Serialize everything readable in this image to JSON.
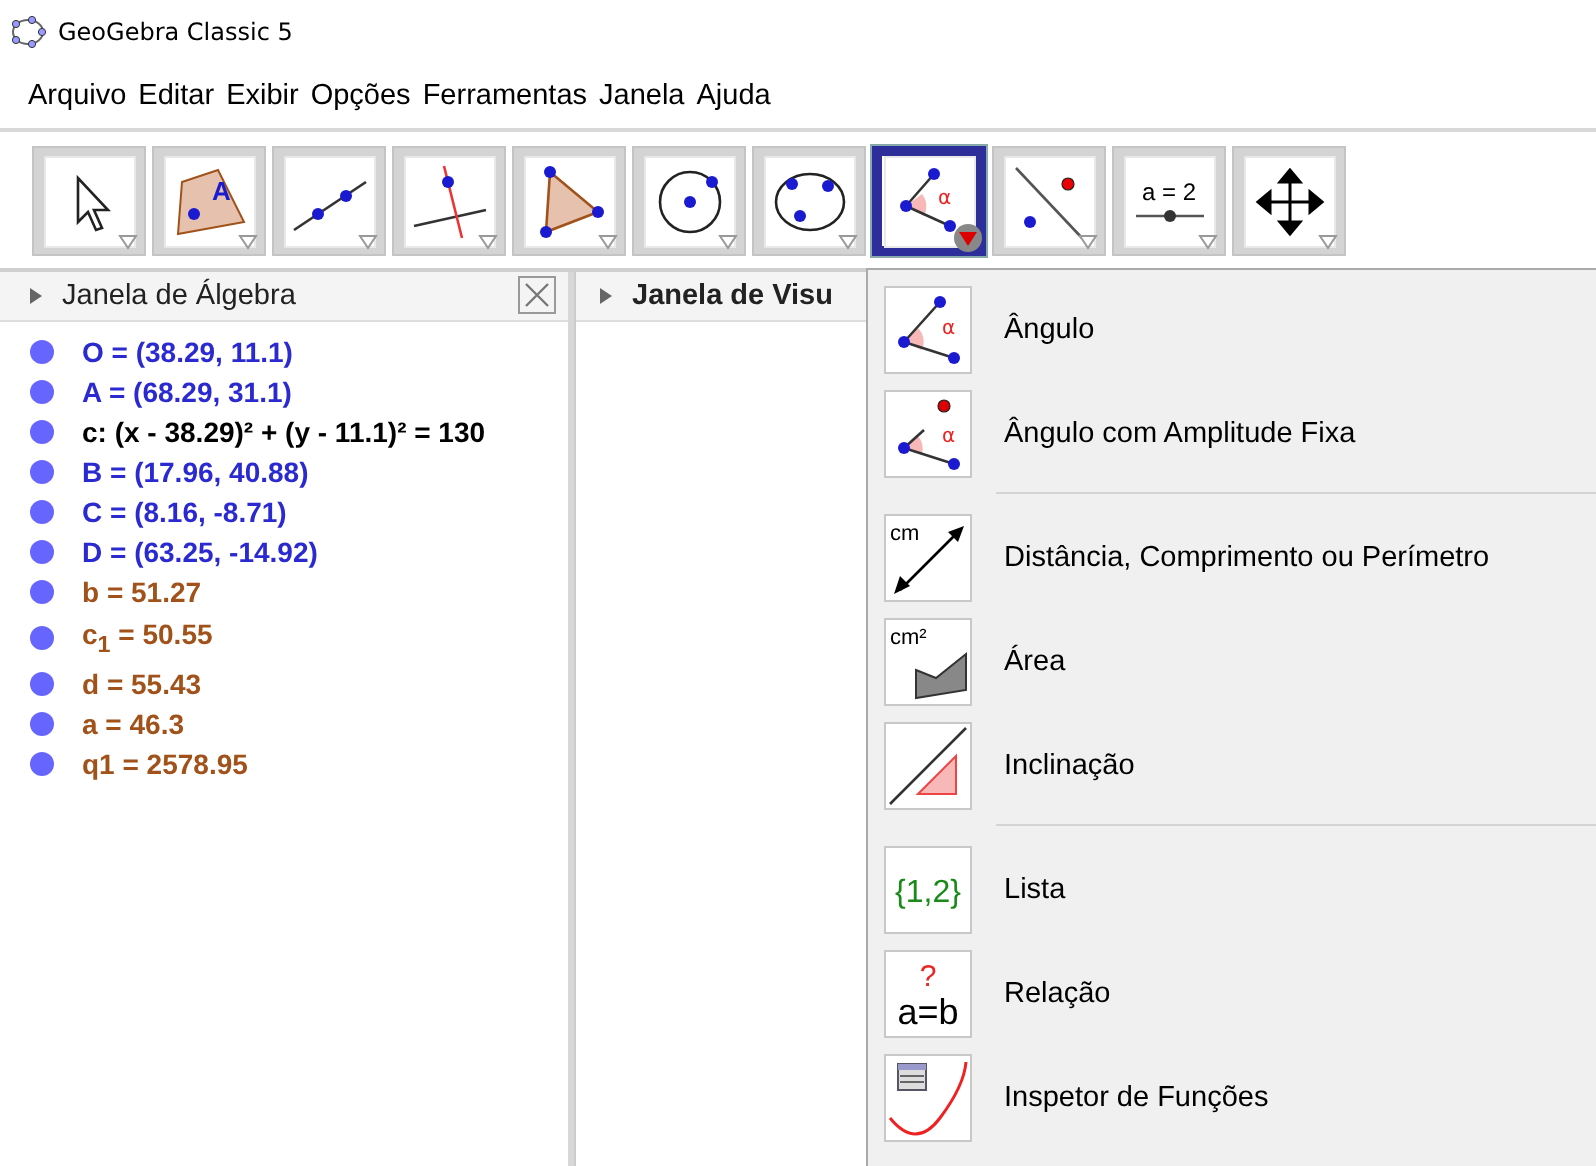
{
  "window": {
    "title": "GeoGebra Classic 5"
  },
  "menu": [
    "Arquivo",
    "Editar",
    "Exibir",
    "Opções",
    "Ferramentas",
    "Janela",
    "Ajuda"
  ],
  "tools": [
    {
      "kind": "move",
      "selected": false
    },
    {
      "kind": "point",
      "selected": false,
      "label": "A"
    },
    {
      "kind": "line",
      "selected": false
    },
    {
      "kind": "perpendicular",
      "selected": false
    },
    {
      "kind": "polygon",
      "selected": false
    },
    {
      "kind": "circle",
      "selected": false
    },
    {
      "kind": "conic",
      "selected": false
    },
    {
      "kind": "angle",
      "selected": true,
      "label": "α"
    },
    {
      "kind": "reflect",
      "selected": false
    },
    {
      "kind": "slider",
      "selected": false,
      "label": "a = 2"
    },
    {
      "kind": "pan",
      "selected": false
    }
  ],
  "algebra": {
    "title": "Janela de Álgebra",
    "items": [
      {
        "kind": "point",
        "text": "O = (38.29, 11.1)"
      },
      {
        "kind": "point",
        "text": "A = (68.29, 31.1)"
      },
      {
        "kind": "conic",
        "text": "c: (x - 38.29)² + (y - 11.1)² = 130"
      },
      {
        "kind": "point",
        "text": "B = (17.96, 40.88)"
      },
      {
        "kind": "point",
        "text": "C = (8.16, -8.71)"
      },
      {
        "kind": "point",
        "text": "D = (63.25, -14.92)"
      },
      {
        "kind": "number",
        "text": "b = 51.27"
      },
      {
        "kind": "number",
        "text": "c$_{1}$ = 50.55"
      },
      {
        "kind": "number",
        "text": "d = 55.43"
      },
      {
        "kind": "number",
        "text": "a = 46.3"
      },
      {
        "kind": "number",
        "text": "q1 = 2578.95"
      }
    ]
  },
  "graphics": {
    "title": "Janela de Visu"
  },
  "dropdown": {
    "groups": [
      [
        {
          "kind": "angle",
          "label": "Ângulo",
          "icon_text": "α"
        },
        {
          "kind": "fixed-angle",
          "label": "Ângulo com Amplitude Fixa",
          "icon_text": "α"
        }
      ],
      [
        {
          "kind": "distance",
          "label": "Distância, Comprimento ou Perímetro",
          "icon_text": "cm"
        },
        {
          "kind": "area",
          "label": "Área",
          "icon_text": "cm²"
        },
        {
          "kind": "slope",
          "label": "Inclinação"
        }
      ],
      [
        {
          "kind": "list",
          "label": "Lista",
          "icon_text": "{1,2}"
        },
        {
          "kind": "relation",
          "label": "Relação",
          "icon_text": "a=b",
          "icon_text_2": "?"
        },
        {
          "kind": "inspector",
          "label": "Inspetor de Funções"
        }
      ]
    ]
  }
}
